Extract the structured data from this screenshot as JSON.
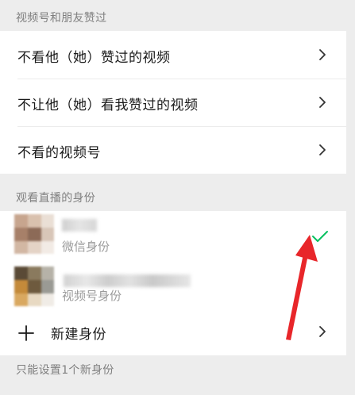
{
  "sections": {
    "friends_likes": {
      "header": "视频号和朋友赞过",
      "rows": [
        {
          "label": "不看他（她）赞过的视频"
        },
        {
          "label": "不让他（她）看我赞过的视频"
        },
        {
          "label": "不看的视频号"
        }
      ]
    },
    "live_identity": {
      "header": "观看直播的身份",
      "identities": [
        {
          "type_label": "微信身份",
          "selected": true
        },
        {
          "type_label": "视频号身份",
          "selected": false
        }
      ],
      "new_identity_label": "新建身份",
      "footer_note": "只能设置1个新身份"
    }
  },
  "icons": {
    "row_chevron": "chevron-right-icon",
    "selected_mark": "checkmark-icon",
    "add": "plus-icon",
    "annotation": "red-arrow"
  },
  "colors": {
    "background": "#ededed",
    "card": "#ffffff",
    "check_green": "#07c160",
    "annotation_red": "#e8262a"
  }
}
